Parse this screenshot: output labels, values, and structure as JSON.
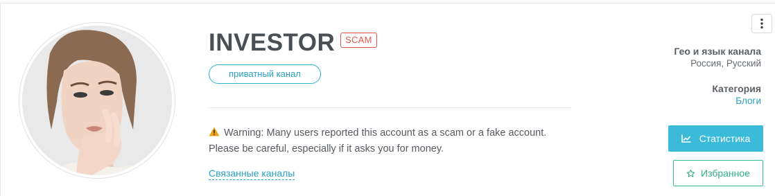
{
  "channel": {
    "title": "INVESTOR",
    "scam_badge": "SCAM",
    "type_pill": "приватный канал",
    "warning_text": "Warning: Many users reported this account as a scam or a fake account. Please be careful, especially if it asks you for money.",
    "warning_line1": "Warning: Many users reported this account as a scam or a fake account.",
    "warning_line2": "Please be careful, especially if it asks you for money.",
    "related_link": "Связанные каналы"
  },
  "meta": {
    "geo_label": "Гео и язык канала",
    "geo_value": "Россия, Русский",
    "category_label": "Категория",
    "category_value": "Блоги"
  },
  "actions": {
    "stats_label": "Статистика",
    "favorite_label": "Избранное"
  },
  "icons": {
    "warning": "warning-icon",
    "chart": "chart-line-icon",
    "star": "star-outline-icon",
    "menu": "kebab-menu-icon"
  },
  "colors": {
    "accent": "#3cbad9",
    "link": "#2a9fc0",
    "scam": "#e3564f",
    "favorite": "#2fbf8e",
    "warning_icon": "#e8a317"
  }
}
